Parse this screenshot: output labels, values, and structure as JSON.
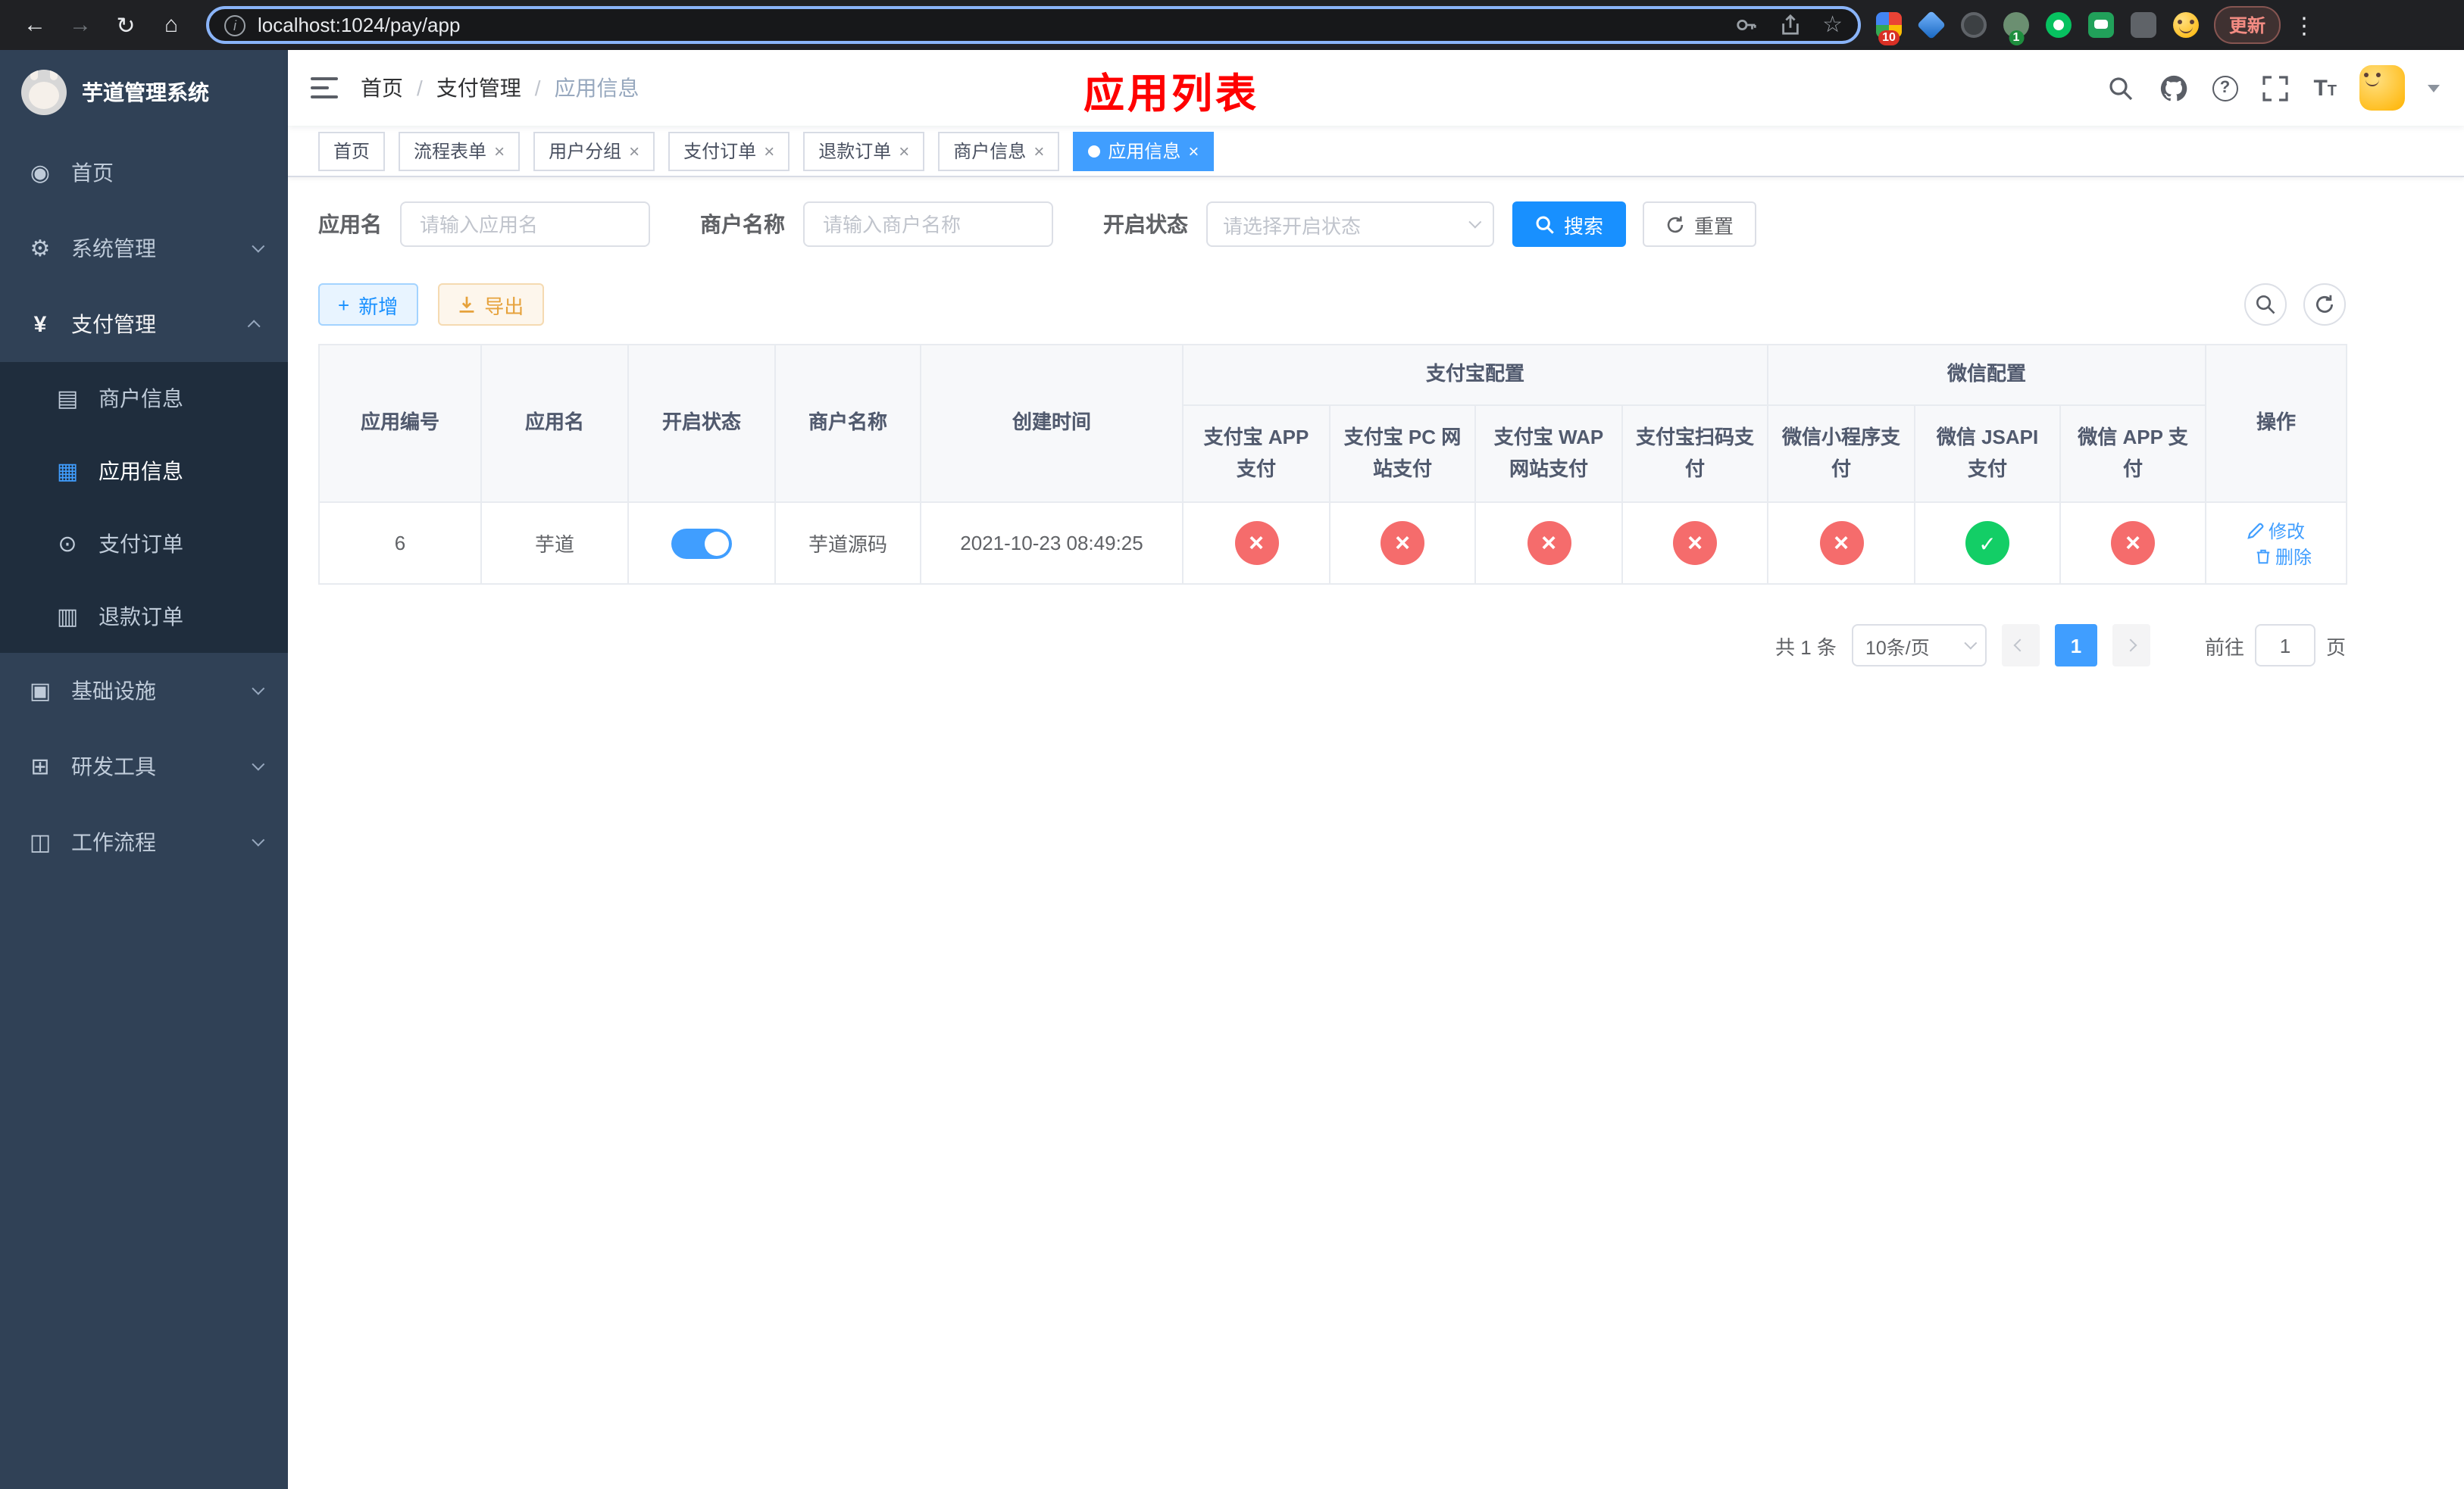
{
  "colors": {
    "accent": "#409eff",
    "primary_button": "#1890ff",
    "danger": "#f56c6c",
    "success": "#13ce66",
    "warning": "#e6a23c",
    "page_title": "#ff0000",
    "sidebar_bg": "#304156",
    "submenu_bg": "#1f2d3d"
  },
  "browser": {
    "url": "localhost:1024/pay/app",
    "update_label": "更新",
    "extension_badge_count": "10",
    "avatar_badge_count": "1"
  },
  "icons": {
    "browser": [
      "back-icon",
      "forward-icon",
      "reload-icon",
      "home-icon",
      "info-icon",
      "key-icon",
      "share-icon",
      "bookmark-star-icon",
      "extensions-puzzle-icon",
      "menu-dots-icon"
    ],
    "navbar": [
      "hamburger-icon",
      "search-icon",
      "github-icon",
      "help-icon",
      "fullscreen-icon",
      "text-size-icon",
      "avatar",
      "caret-down-icon"
    ],
    "sidebar": [
      "dashboard-icon",
      "gear-icon",
      "yen-icon",
      "merchant-card-icon",
      "app-grid-icon",
      "order-icon",
      "refund-doc-icon",
      "infra-icon",
      "devtools-icon",
      "workflow-icon"
    ]
  },
  "sidebar": {
    "title": "芋道管理系统",
    "home": "首页",
    "system": "系统管理",
    "pay": "支付管理",
    "merchant_info": "商户信息",
    "app_info": "应用信息",
    "pay_order": "支付订单",
    "refund_order": "退款订单",
    "infra": "基础设施",
    "dev_tools": "研发工具",
    "workflow": "工作流程"
  },
  "navbar": {
    "breadcrumb_home": "首页",
    "breadcrumb_pay": "支付管理",
    "breadcrumb_app": "应用信息",
    "page_title": "应用列表"
  },
  "tabs": {
    "t0": "首页",
    "t1": "流程表单",
    "t2": "用户分组",
    "t3": "支付订单",
    "t4": "退款订单",
    "t5": "商户信息",
    "t6": "应用信息",
    "active": "应用信息"
  },
  "filters": {
    "app_name_label": "应用名",
    "app_name_placeholder": "请输入应用名",
    "merchant_label": "商户名称",
    "merchant_placeholder": "请输入商户名称",
    "status_label": "开启状态",
    "status_placeholder": "请选择开启状态",
    "search_label": "搜索",
    "reset_label": "重置"
  },
  "toolbar": {
    "add_label": "新增",
    "export_label": "导出"
  },
  "table": {
    "group_alipay": "支付宝配置",
    "group_wechat": "微信配置",
    "col_id": "应用编号",
    "col_name": "应用名",
    "col_status": "开启状态",
    "col_merchant": "商户名称",
    "col_created": "创建时间",
    "col_alipay_app": "支付宝 APP 支付",
    "col_alipay_pc": "支付宝 PC 网站支付",
    "col_alipay_wap": "支付宝 WAP 网站支付",
    "col_alipay_qr": "支付宝扫码支付",
    "col_wx_mini": "微信小程序支付",
    "col_wx_jsapi": "微信 JSAPI 支付",
    "col_wx_app": "微信 APP 支付",
    "col_actions": "操作",
    "row": {
      "id": "6",
      "name": "芋道",
      "enabled": "true",
      "merchant": "芋道源码",
      "created": "2021-10-23 08:49:25",
      "alipay_app": "fail",
      "alipay_pc": "fail",
      "alipay_wap": "fail",
      "alipay_qr": "fail",
      "wx_mini": "fail",
      "wx_jsapi": "success",
      "wx_app": "fail",
      "edit_label": "修改",
      "delete_label": "删除"
    }
  },
  "pagination": {
    "total_label": "共 1 条",
    "page_size_label": "10条/页",
    "current_page": "1",
    "goto_label": "前往",
    "goto_value": "1",
    "page_unit": "页"
  }
}
